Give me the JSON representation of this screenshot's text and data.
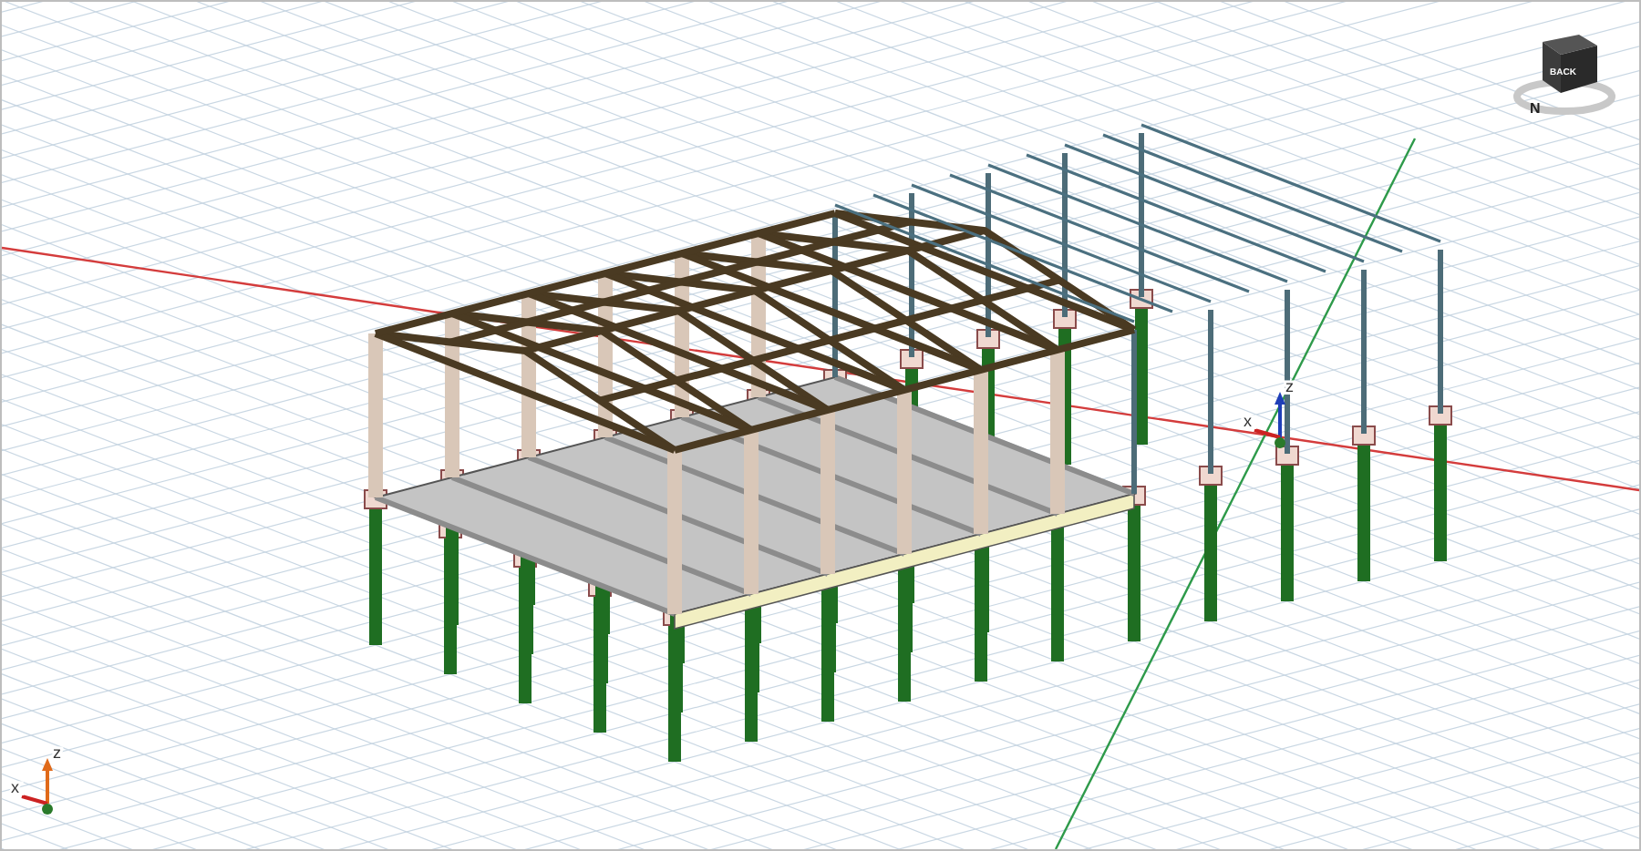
{
  "viewport": {
    "view_cube": {
      "face_label": "BACK",
      "compass_label": "N"
    },
    "axis_triad": {
      "x_label": "x",
      "z_label": "z"
    },
    "corner_triad": {
      "x_label": "x",
      "z_label": "z"
    }
  }
}
